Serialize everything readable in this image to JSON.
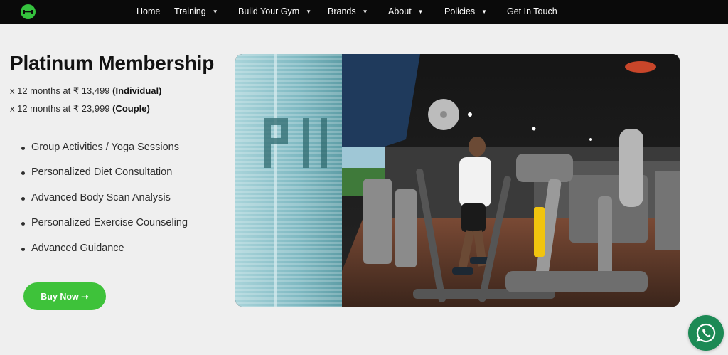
{
  "nav": {
    "logo": "dumbbell-icon",
    "items": [
      {
        "label": "Home",
        "dropdown": false
      },
      {
        "label": "Training",
        "dropdown": true
      },
      {
        "label": "Build Your Gym",
        "dropdown": true
      },
      {
        "label": "Brands",
        "dropdown": true
      },
      {
        "label": "About",
        "dropdown": true
      },
      {
        "label": "Policies",
        "dropdown": true
      },
      {
        "label": "Get In Touch",
        "dropdown": false
      }
    ]
  },
  "plan": {
    "title": "Platinum Membership",
    "prices": [
      {
        "text": "x 12 months at ₹ 13,499 ",
        "type": "(Individual)"
      },
      {
        "text": "x 12 months at ₹ 23,999 ",
        "type": "(Couple)"
      }
    ],
    "benefits": [
      "Group Activities / Yoga Sessions",
      "Personalized Diet Consultation",
      "Advanced Body Scan Analysis",
      "Personalized Exercise Counseling",
      "Advanced Guidance"
    ],
    "buy_label": "Buy Now ➝"
  },
  "hero_image": "gym-cross-trainer-photo",
  "whatsapp": "whatsapp-icon",
  "colors": {
    "accent_green": "#3ec23a",
    "navbar_bg": "#0a0a0a",
    "whatsapp_green": "#1c8a55",
    "page_bg": "#efefef"
  }
}
